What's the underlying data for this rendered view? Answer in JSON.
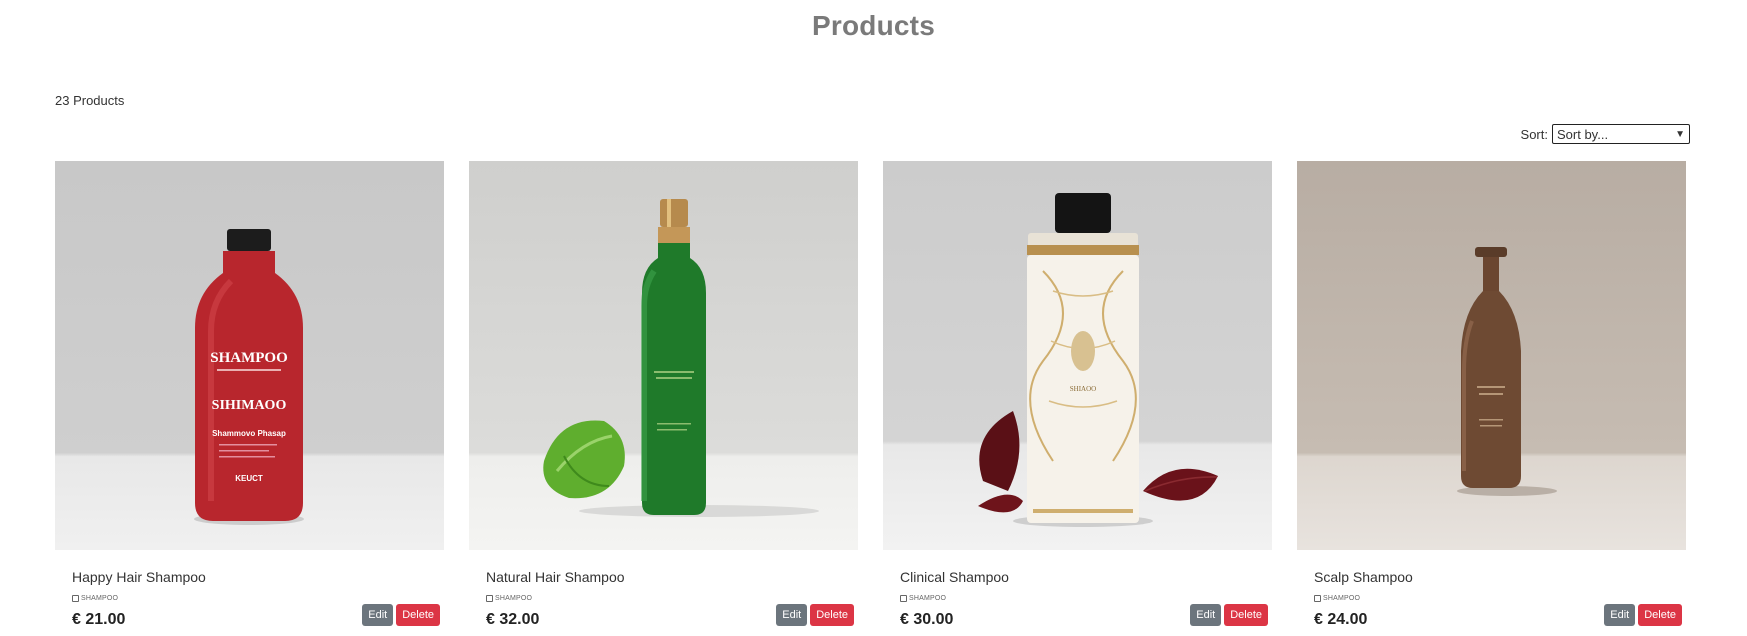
{
  "page": {
    "title": "Products"
  },
  "summary": {
    "count_text": "23 Products"
  },
  "sort": {
    "label": "Sort:",
    "selected": "Sort by..."
  },
  "products": [
    {
      "name": "Happy Hair Shampoo",
      "category": "SHAMPOO",
      "price": "€ 21.00",
      "edit_label": "Edit",
      "delete_label": "Delete",
      "image_text": [
        "SHAMPOO",
        "SIHIMAOO",
        "Shammovo Phasap",
        "KEUCT"
      ]
    },
    {
      "name": "Natural Hair Shampoo",
      "category": "SHAMPOO",
      "price": "€ 32.00",
      "edit_label": "Edit",
      "delete_label": "Delete"
    },
    {
      "name": "Clinical Shampoo",
      "category": "SHAMPOO",
      "price": "€ 30.00",
      "edit_label": "Edit",
      "delete_label": "Delete",
      "image_text": [
        "SHIAOO"
      ]
    },
    {
      "name": "Scalp Shampoo",
      "category": "SHAMPOO",
      "price": "€ 24.00",
      "edit_label": "Edit",
      "delete_label": "Delete"
    }
  ],
  "colors": {
    "edit_button": "#6c757d",
    "delete_button": "#dc3545",
    "title": "#7a7a7a"
  }
}
